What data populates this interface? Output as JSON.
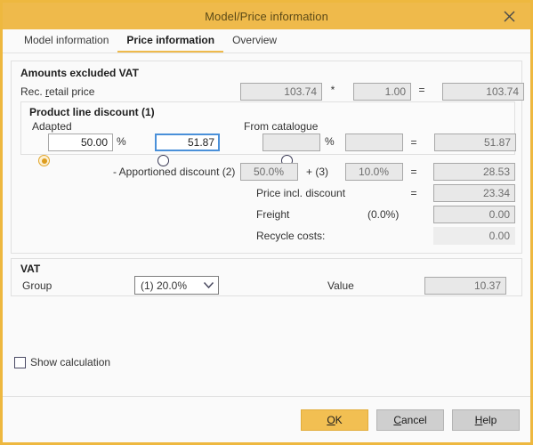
{
  "window": {
    "title": "Model/Price information",
    "close_icon": "close-icon"
  },
  "tabs": [
    {
      "label": "Model information",
      "active": false
    },
    {
      "label": "Price information",
      "active": true
    },
    {
      "label": "Overview",
      "active": false
    }
  ],
  "amounts": {
    "section_title": "Amounts excluded VAT",
    "retail": {
      "label_pre": "Rec. ",
      "label_accel": "r",
      "label_post": "etail price",
      "base": "103.74",
      "op1": "*",
      "factor": "1.00",
      "op2": "=",
      "total": "103.74"
    },
    "product_line_discount": {
      "title": "Product line discount (1)",
      "adapted_label": "Adapted",
      "catalogue_label": "From catalogue",
      "adapted_percent": "50.00",
      "percent_sign": "%",
      "adapted_amount": "51.87",
      "catalogue_percent": "",
      "catalogue_percent_sign": "%",
      "catalogue_middle": "",
      "catalogue_eq": "=",
      "catalogue_amount": "51.87",
      "adapted_selected": true,
      "amount_selected": false,
      "catalogue_selected": false
    },
    "apportioned": {
      "label": "- Apportioned discount (2)",
      "value1": "50.0%",
      "plus": "+ (3)",
      "value2": "10.0%",
      "eq": "=",
      "result": "28.53"
    },
    "price_incl": {
      "label": "Price incl. discount",
      "eq": "=",
      "value": "23.34"
    },
    "freight": {
      "label": "Freight",
      "percent": "(0.0%)",
      "value": "0.00"
    },
    "recycle": {
      "label": "Recycle costs:",
      "value": "0.00"
    }
  },
  "vat": {
    "section_title": "VAT",
    "group_label": "Group",
    "group_value": "(1) 20.0%",
    "chevron_icon": "chevron-down-icon",
    "value_label": "Value",
    "value": "10.37"
  },
  "show_calculation": {
    "label": "Show calculation",
    "checked": false
  },
  "footer": {
    "ok": {
      "accel": "O",
      "rest": "K"
    },
    "cancel": {
      "accel": "C",
      "rest": "ancel"
    },
    "help": {
      "accel": "H",
      "rest": "elp"
    }
  },
  "colors": {
    "accent": "#efba4b",
    "title_text": "#5c4a17",
    "focus_border": "#4a90d9",
    "radio_fill": "#dd9c1d",
    "field_bg": "#e8e8e8",
    "button_bg": "#cfcfcf"
  }
}
